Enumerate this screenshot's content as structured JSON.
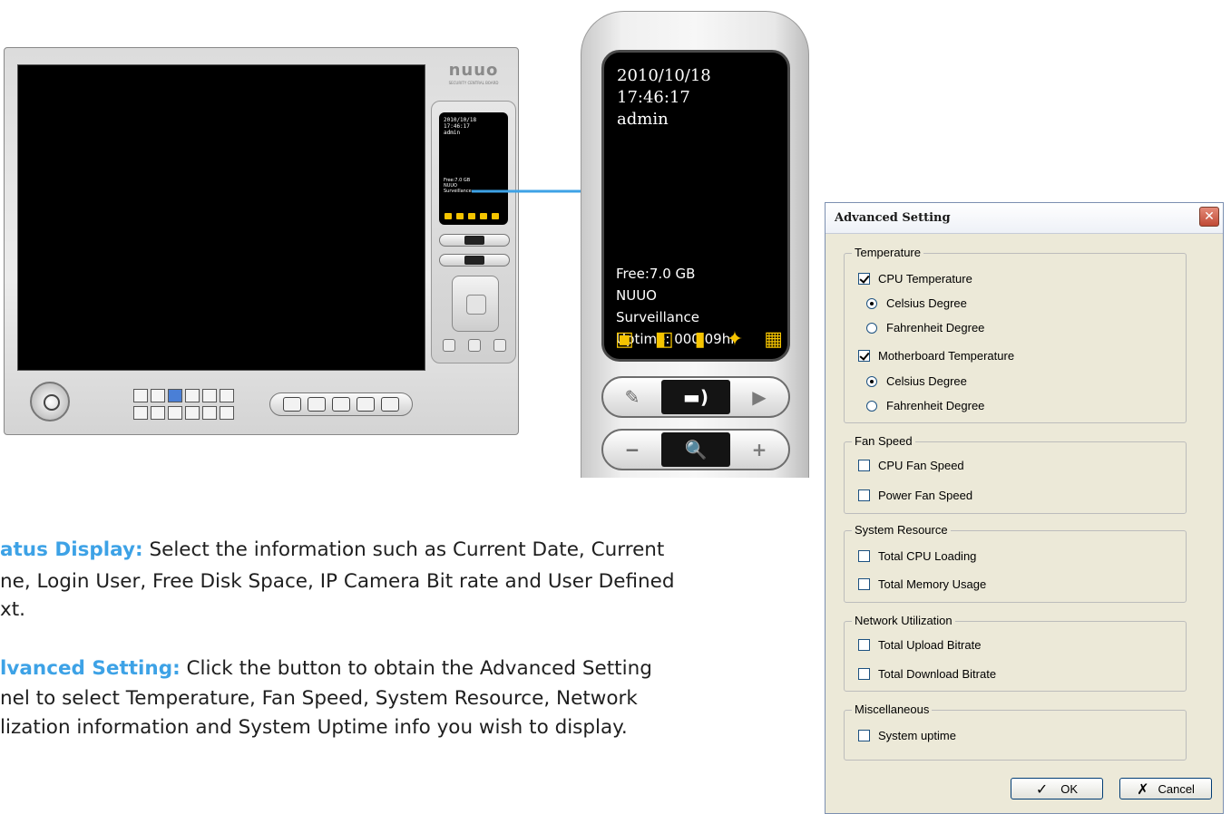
{
  "status_panel": {
    "date": "2010/10/18",
    "time": "17:46:17",
    "user": "admin",
    "free": "Free:7.0 GB",
    "line1": "NUUO",
    "line2": "Surveillance",
    "uptime": "Uptime: 000.09hr",
    "icons": [
      "monitor-icon",
      "speaker-icon",
      "phone-icon",
      "satellite-icon",
      "keyboard-icon"
    ],
    "row1": [
      "wrench-icon",
      "camera-bitrate-icon",
      "play-icon"
    ],
    "row2": [
      "zoom-out-icon",
      "zoom-icon",
      "zoom-in-icon"
    ]
  },
  "mini_panel": {
    "logo": "nuuo",
    "logo_sub": "SECURITY CENTRAL BOARD",
    "date": "2010/10/18",
    "time": "17:46:17",
    "user": "admin",
    "free": "Free:7.0 GB",
    "line1": "NUUO",
    "line2": "Surveillance"
  },
  "captions": {
    "status_title": "atus Display:",
    "status_line1": " Select the information such as Current Date, Current",
    "status_line2": "ne, Login User, Free Disk Space, IP Camera Bit rate and User Defined",
    "status_line3": "xt.",
    "adv_title": "lvanced Setting:",
    "adv_line1": " Click the button to obtain the Advanced Setting",
    "adv_line2": "nel to select Temperature, Fan Speed, System Resource, Network",
    "adv_line3": "lization information and System Uptime info you wish to display."
  },
  "dialog": {
    "title": "Advanced Setting",
    "close": "✕",
    "groups": {
      "temperature": {
        "label": "Temperature",
        "cpu": "CPU Temperature",
        "cpu_celsius": "Celsius Degree",
        "cpu_fahrenheit": "Fahrenheit Degree",
        "mb": "Motherboard Temperature",
        "mb_celsius": "Celsius Degree",
        "mb_fahrenheit": "Fahrenheit Degree"
      },
      "fan": {
        "label": "Fan Speed",
        "cpu": "CPU Fan Speed",
        "power": "Power Fan Speed"
      },
      "resource": {
        "label": "System Resource",
        "cpu": "Total CPU Loading",
        "mem": "Total Memory Usage"
      },
      "network": {
        "label": "Network Utilization",
        "upload": "Total Upload Bitrate",
        "download": "Total Download Bitrate"
      },
      "misc": {
        "label": "Miscellaneous",
        "uptime": "System uptime"
      }
    },
    "ok": "OK",
    "cancel": "Cancel",
    "ok_icon": "✓",
    "cancel_icon": "✗"
  }
}
